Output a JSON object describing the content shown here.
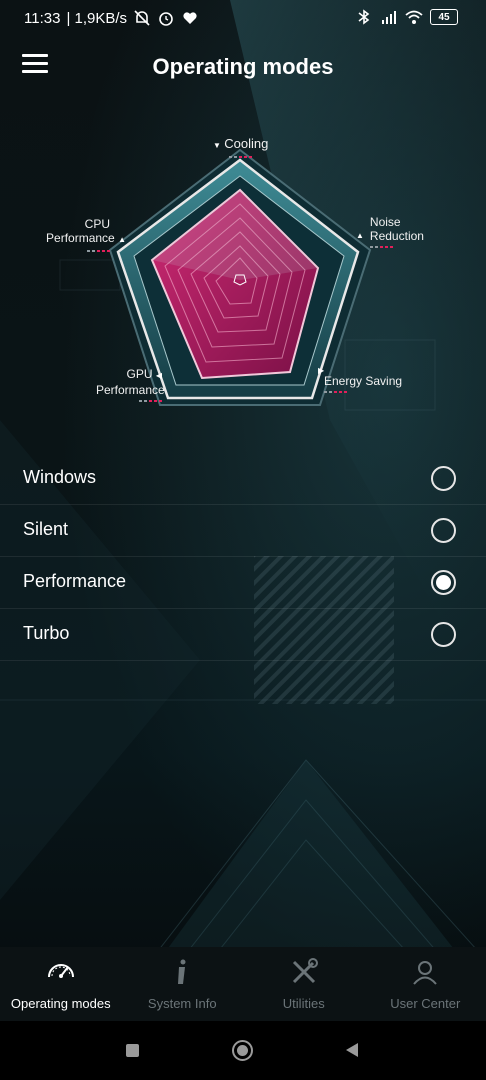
{
  "status_bar": {
    "time": "11:33",
    "speed": "| 1,9KB/s",
    "battery": "45"
  },
  "app_bar": {
    "title": "Operating modes",
    "menu_icon": "hamburger-menu-icon"
  },
  "radar": {
    "labels": {
      "cooling": "Cooling",
      "noise_line1": "Noise",
      "noise_line2": "Reduction",
      "energy": "Energy Saving",
      "gpu_line1": "GPU",
      "gpu_line2": "Performance",
      "cpu_line1": "CPU",
      "cpu_line2": "Performance"
    },
    "accent_color": "#e0205a"
  },
  "modes": [
    {
      "label": "Windows",
      "selected": false
    },
    {
      "label": "Silent",
      "selected": false
    },
    {
      "label": "Performance",
      "selected": true
    },
    {
      "label": "Turbo",
      "selected": false
    }
  ],
  "bottom_nav": [
    {
      "label": "Operating modes",
      "icon": "speedometer-icon",
      "active": true
    },
    {
      "label": "System Info",
      "icon": "info-icon",
      "active": false
    },
    {
      "label": "Utilities",
      "icon": "tools-icon",
      "active": false
    },
    {
      "label": "User Center",
      "icon": "user-icon",
      "active": false
    }
  ]
}
